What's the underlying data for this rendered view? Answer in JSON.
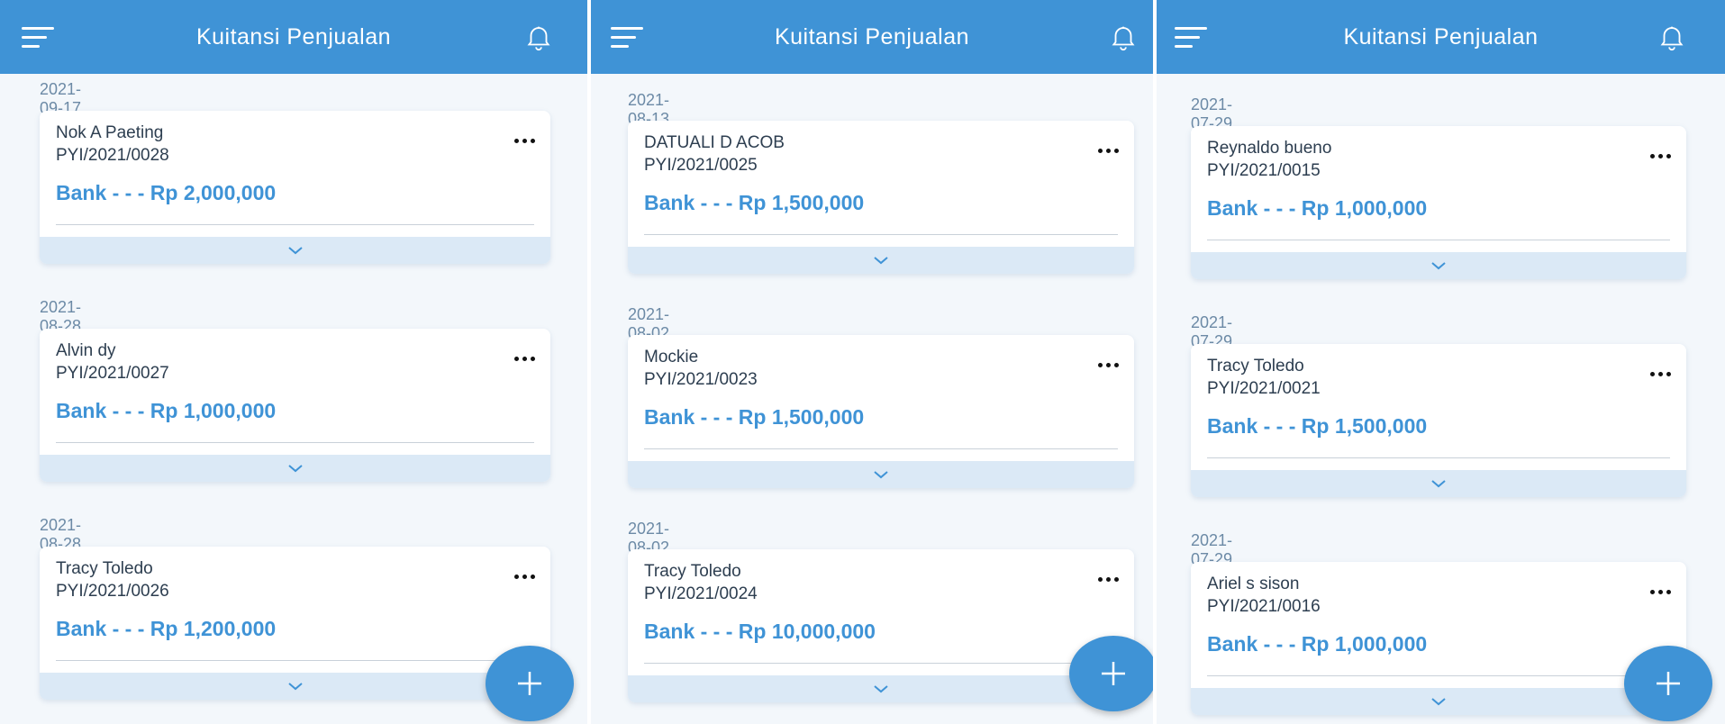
{
  "colors": {
    "appbar": "#3f93d6",
    "amount": "#3f93d6",
    "card_footer": "#dbe9f6",
    "date": "#6c8aa6",
    "background": "#f3f7fb"
  },
  "icons": {
    "menu": "menu-icon",
    "notification": "bell-icon",
    "more": "more-horizontal-icon",
    "expand": "chevron-down-icon",
    "add": "plus-icon"
  },
  "panels": [
    {
      "title": "Kuitansi Penjualan",
      "receipts": [
        {
          "date": "2021-09-17",
          "customer": "Nok A Paeting",
          "number": "PYI/2021/0028",
          "amount": "Bank - - - Rp 2,000,000"
        },
        {
          "date": "2021-08-28",
          "customer": "Alvin dy",
          "number": "PYI/2021/0027",
          "amount": "Bank - - - Rp 1,000,000"
        },
        {
          "date": "2021-08-28",
          "customer": "Tracy Toledo",
          "number": "PYI/2021/0026",
          "amount": "Bank - - - Rp 1,200,000"
        }
      ]
    },
    {
      "title": "Kuitansi Penjualan",
      "receipts": [
        {
          "date": "2021-08-13",
          "customer": "DATUALI D ACOB",
          "number": "PYI/2021/0025",
          "amount": "Bank - - - Rp 1,500,000"
        },
        {
          "date": "2021-08-02",
          "customer": "Mockie",
          "number": "PYI/2021/0023",
          "amount": "Bank - - - Rp 1,500,000"
        },
        {
          "date": "2021-08-02",
          "customer": "Tracy Toledo",
          "number": "PYI/2021/0024",
          "amount": "Bank - - - Rp 10,000,000"
        }
      ]
    },
    {
      "title": "Kuitansi Penjualan",
      "receipts": [
        {
          "date": "2021-07-29",
          "customer": "Reynaldo bueno",
          "number": "PYI/2021/0015",
          "amount": "Bank - - - Rp 1,000,000"
        },
        {
          "date": "2021-07-29",
          "customer": "Tracy Toledo",
          "number": "PYI/2021/0021",
          "amount": "Bank - - - Rp 1,500,000"
        },
        {
          "date": "2021-07-29",
          "customer": "Ariel s sison",
          "number": "PYI/2021/0016",
          "amount": "Bank - - - Rp 1,000,000"
        }
      ]
    }
  ]
}
